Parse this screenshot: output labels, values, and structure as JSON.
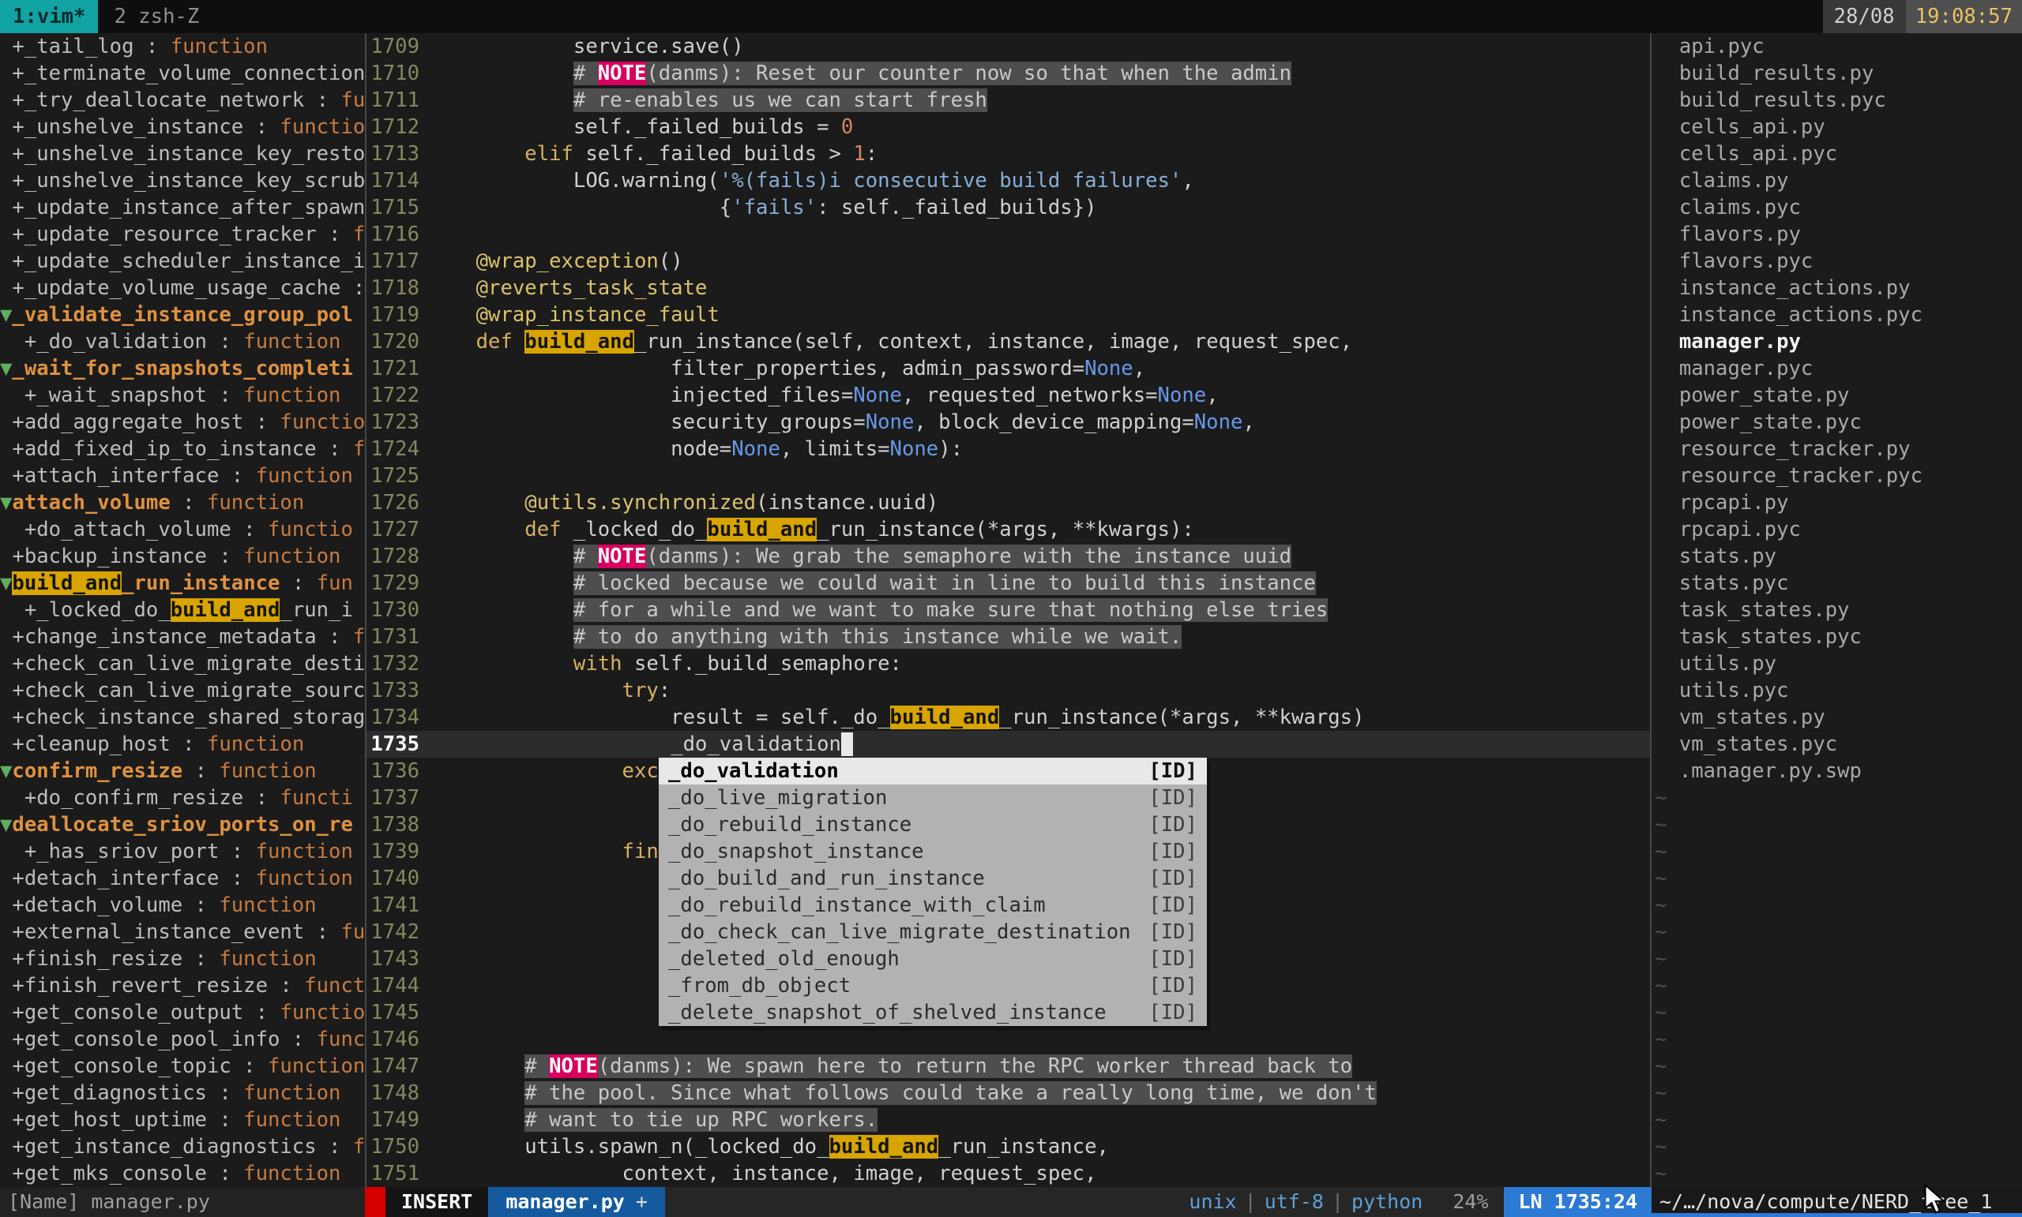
{
  "tmux_bar": {
    "window_active": "1:vim*",
    "window_inactive": "2 zsh-Z",
    "date": "28/08",
    "time": "19:08:57"
  },
  "tagbar": {
    "rows": [
      {
        "segs": [
          [
            "tn",
            " +_tail_log : "
          ],
          [
            "tt",
            "function"
          ]
        ]
      },
      {
        "segs": [
          [
            "tn",
            " +_terminate_volume_connection"
          ]
        ]
      },
      {
        "segs": [
          [
            "tn",
            " +_try_deallocate_network : "
          ],
          [
            "tt",
            "fu"
          ]
        ]
      },
      {
        "segs": [
          [
            "tn",
            " +_unshelve_instance : "
          ],
          [
            "tt",
            "functio"
          ]
        ]
      },
      {
        "segs": [
          [
            "tn",
            " +_unshelve_instance_key_resto"
          ]
        ]
      },
      {
        "segs": [
          [
            "tn",
            " +_unshelve_instance_key_scrub"
          ]
        ]
      },
      {
        "segs": [
          [
            "tn",
            " +_update_instance_after_spawn"
          ]
        ]
      },
      {
        "segs": [
          [
            "tn",
            " +_update_resource_tracker : "
          ],
          [
            "tt",
            "f"
          ]
        ]
      },
      {
        "segs": [
          [
            "tn",
            " +_update_scheduler_instance_i"
          ]
        ]
      },
      {
        "segs": [
          [
            "tn",
            " +_update_volume_usage_cache :"
          ]
        ]
      },
      {
        "segs": [
          [
            "ar",
            "▼"
          ],
          [
            "to",
            "_validate_instance_group_pol"
          ]
        ]
      },
      {
        "segs": [
          [
            "tn",
            "  +_do_validation : "
          ],
          [
            "tt",
            "function"
          ]
        ]
      },
      {
        "segs": [
          [
            "ar",
            "▼"
          ],
          [
            "to",
            "_wait_for_snapshots_completi"
          ]
        ]
      },
      {
        "segs": [
          [
            "tn",
            "  +_wait_snapshot : "
          ],
          [
            "tt",
            "function"
          ]
        ]
      },
      {
        "segs": [
          [
            "tn",
            " +add_aggregate_host : "
          ],
          [
            "tt",
            "functio"
          ]
        ]
      },
      {
        "segs": [
          [
            "tn",
            " +add_fixed_ip_to_instance : "
          ],
          [
            "tt",
            "f"
          ]
        ]
      },
      {
        "segs": [
          [
            "tn",
            " +attach_interface : "
          ],
          [
            "tt",
            "function"
          ]
        ]
      },
      {
        "segs": [
          [
            "ar",
            "▼"
          ],
          [
            "to",
            "attach_volume"
          ],
          [
            "tn",
            " : "
          ],
          [
            "tt",
            "function"
          ]
        ]
      },
      {
        "segs": [
          [
            "tn",
            "  +do_attach_volume : "
          ],
          [
            "tt",
            "functio"
          ]
        ]
      },
      {
        "segs": [
          [
            "tn",
            " +backup_instance : "
          ],
          [
            "tt",
            "function"
          ]
        ]
      },
      {
        "segs": [
          [
            "ar",
            "▼"
          ],
          [
            "h",
            "build_and"
          ],
          [
            "to",
            "_run_instance"
          ],
          [
            "tn",
            " : "
          ],
          [
            "tt",
            "fun"
          ]
        ]
      },
      {
        "segs": [
          [
            "tn",
            "  +_locked_do_"
          ],
          [
            "h",
            "build_and"
          ],
          [
            "tn",
            "_run_i"
          ]
        ]
      },
      {
        "segs": [
          [
            "tn",
            " +change_instance_metadata : "
          ],
          [
            "tt",
            "f"
          ]
        ]
      },
      {
        "segs": [
          [
            "tn",
            " +check_can_live_migrate_desti"
          ]
        ]
      },
      {
        "segs": [
          [
            "tn",
            " +check_can_live_migrate_sourc"
          ]
        ]
      },
      {
        "segs": [
          [
            "tn",
            " +check_instance_shared_storag"
          ]
        ]
      },
      {
        "segs": [
          [
            "tn",
            " +cleanup_host : "
          ],
          [
            "tt",
            "function"
          ]
        ]
      },
      {
        "segs": [
          [
            "ar",
            "▼"
          ],
          [
            "to",
            "confirm_resize"
          ],
          [
            "tn",
            " : "
          ],
          [
            "tt",
            "function"
          ]
        ]
      },
      {
        "segs": [
          [
            "tn",
            "  +do_confirm_resize : "
          ],
          [
            "tt",
            "functi"
          ]
        ]
      },
      {
        "segs": [
          [
            "ar",
            "▼"
          ],
          [
            "to",
            "deallocate_sriov_ports_on_re"
          ]
        ]
      },
      {
        "segs": [
          [
            "tn",
            "  +_has_sriov_port : "
          ],
          [
            "tt",
            "function"
          ]
        ]
      },
      {
        "segs": [
          [
            "tn",
            " +detach_interface : "
          ],
          [
            "tt",
            "function"
          ]
        ]
      },
      {
        "segs": [
          [
            "tn",
            " +detach_volume : "
          ],
          [
            "tt",
            "function"
          ]
        ]
      },
      {
        "segs": [
          [
            "tn",
            " +external_instance_event : "
          ],
          [
            "tt",
            "fu"
          ]
        ]
      },
      {
        "segs": [
          [
            "tn",
            " +finish_resize : "
          ],
          [
            "tt",
            "function"
          ]
        ]
      },
      {
        "segs": [
          [
            "tn",
            " +finish_revert_resize : "
          ],
          [
            "tt",
            "funct"
          ]
        ]
      },
      {
        "segs": [
          [
            "tn",
            " +get_console_output : "
          ],
          [
            "tt",
            "functio"
          ]
        ]
      },
      {
        "segs": [
          [
            "tn",
            " +get_console_pool_info : "
          ],
          [
            "tt",
            "func"
          ]
        ]
      },
      {
        "segs": [
          [
            "tn",
            " +get_console_topic : "
          ],
          [
            "tt",
            "function"
          ]
        ]
      },
      {
        "segs": [
          [
            "tn",
            " +get_diagnostics : "
          ],
          [
            "tt",
            "function"
          ]
        ]
      },
      {
        "segs": [
          [
            "tn",
            " +get_host_uptime : "
          ],
          [
            "tt",
            "function"
          ]
        ]
      },
      {
        "segs": [
          [
            "tn",
            " +get_instance_diagnostics : "
          ],
          [
            "tt",
            "f"
          ]
        ]
      },
      {
        "segs": [
          [
            "tn",
            " +get_mks_console : "
          ],
          [
            "tt",
            "function"
          ]
        ]
      }
    ]
  },
  "editor": {
    "cursor_line": 1735,
    "lines": [
      {
        "num": 1709,
        "segs": [
          [
            "t",
            "            service.save()"
          ]
        ]
      },
      {
        "num": 1710,
        "segs": [
          [
            "t",
            "            "
          ],
          [
            "c",
            "# "
          ],
          [
            "x",
            "NOTE"
          ],
          [
            "c",
            "(danms): Reset our counter now so that when the admin"
          ]
        ]
      },
      {
        "num": 1711,
        "segs": [
          [
            "t",
            "            "
          ],
          [
            "c",
            "# re-enables us we can start fresh"
          ]
        ]
      },
      {
        "num": 1712,
        "segs": [
          [
            "t",
            "            self._failed_builds = "
          ],
          [
            "n",
            "0"
          ]
        ]
      },
      {
        "num": 1713,
        "segs": [
          [
            "t",
            "        "
          ],
          [
            "k",
            "elif"
          ],
          [
            "t",
            " self._failed_builds > "
          ],
          [
            "n",
            "1"
          ],
          [
            "t",
            ":"
          ]
        ]
      },
      {
        "num": 1714,
        "segs": [
          [
            "t",
            "            LOG.warning("
          ],
          [
            "s",
            "'%(fails)i consecutive build failures'"
          ],
          [
            "t",
            ","
          ]
        ]
      },
      {
        "num": 1715,
        "segs": [
          [
            "t",
            "                        {"
          ],
          [
            "s",
            "'fails'"
          ],
          [
            "t",
            ": self._failed_builds})"
          ]
        ]
      },
      {
        "num": 1716,
        "segs": []
      },
      {
        "num": 1717,
        "segs": [
          [
            "t",
            "    "
          ],
          [
            "d",
            "@wrap_exception"
          ],
          [
            "t",
            "()"
          ]
        ]
      },
      {
        "num": 1718,
        "segs": [
          [
            "t",
            "    "
          ],
          [
            "d",
            "@reverts_task_state"
          ]
        ]
      },
      {
        "num": 1719,
        "segs": [
          [
            "t",
            "    "
          ],
          [
            "d",
            "@wrap_instance_fault"
          ]
        ]
      },
      {
        "num": 1720,
        "segs": [
          [
            "t",
            "    "
          ],
          [
            "k",
            "def"
          ],
          [
            "t",
            " "
          ],
          [
            "h",
            "build_and"
          ],
          [
            "t",
            "_run_instance(self, context, instance, image, request_spec,"
          ]
        ]
      },
      {
        "num": 1721,
        "segs": [
          [
            "t",
            "                    filter_properties, admin_password="
          ],
          [
            "N",
            "None"
          ],
          [
            "t",
            ","
          ]
        ]
      },
      {
        "num": 1722,
        "segs": [
          [
            "t",
            "                    injected_files="
          ],
          [
            "N",
            "None"
          ],
          [
            "t",
            ", requested_networks="
          ],
          [
            "N",
            "None"
          ],
          [
            "t",
            ","
          ]
        ]
      },
      {
        "num": 1723,
        "segs": [
          [
            "t",
            "                    security_groups="
          ],
          [
            "N",
            "None"
          ],
          [
            "t",
            ", block_device_mapping="
          ],
          [
            "N",
            "None"
          ],
          [
            "t",
            ","
          ]
        ]
      },
      {
        "num": 1724,
        "segs": [
          [
            "t",
            "                    node="
          ],
          [
            "N",
            "None"
          ],
          [
            "t",
            ", limits="
          ],
          [
            "N",
            "None"
          ],
          [
            "t",
            "):"
          ]
        ]
      },
      {
        "num": 1725,
        "segs": []
      },
      {
        "num": 1726,
        "segs": [
          [
            "t",
            "        "
          ],
          [
            "d",
            "@utils.synchronized"
          ],
          [
            "t",
            "(instance.uuid)"
          ]
        ]
      },
      {
        "num": 1727,
        "segs": [
          [
            "t",
            "        "
          ],
          [
            "k",
            "def"
          ],
          [
            "t",
            " _locked_do_"
          ],
          [
            "h",
            "build_and"
          ],
          [
            "t",
            "_run_instance(*args, **kwargs):"
          ]
        ]
      },
      {
        "num": 1728,
        "segs": [
          [
            "t",
            "            "
          ],
          [
            "c",
            "# "
          ],
          [
            "x",
            "NOTE"
          ],
          [
            "c",
            "(danms): We grab the semaphore with the instance uuid"
          ]
        ]
      },
      {
        "num": 1729,
        "segs": [
          [
            "t",
            "            "
          ],
          [
            "c",
            "# locked because we could wait in line to build this instance"
          ]
        ]
      },
      {
        "num": 1730,
        "segs": [
          [
            "t",
            "            "
          ],
          [
            "c",
            "# for a while and we want to make sure that nothing else tries"
          ]
        ]
      },
      {
        "num": 1731,
        "segs": [
          [
            "t",
            "            "
          ],
          [
            "c",
            "# to do anything with this instance while we wait."
          ]
        ]
      },
      {
        "num": 1732,
        "segs": [
          [
            "t",
            "            "
          ],
          [
            "k",
            "with"
          ],
          [
            "t",
            " self._build_semaphore:"
          ]
        ]
      },
      {
        "num": 1733,
        "segs": [
          [
            "t",
            "                "
          ],
          [
            "k",
            "try"
          ],
          [
            "t",
            ":"
          ]
        ]
      },
      {
        "num": 1734,
        "segs": [
          [
            "t",
            "                    result = self._do_"
          ],
          [
            "h",
            "build_and"
          ],
          [
            "t",
            "_run_instance(*args, **kwargs)"
          ]
        ]
      },
      {
        "num": 1735,
        "segs": [
          [
            "t",
            "                    _do_validation"
          ],
          [
            "cur",
            " "
          ]
        ]
      },
      {
        "num": 1736,
        "segs": [
          [
            "t",
            "                "
          ],
          [
            "k",
            "exc"
          ]
        ]
      },
      {
        "num": 1737,
        "segs": []
      },
      {
        "num": 1738,
        "segs": []
      },
      {
        "num": 1739,
        "segs": [
          [
            "t",
            "                "
          ],
          [
            "k",
            "fin"
          ]
        ]
      },
      {
        "num": 1740,
        "segs": []
      },
      {
        "num": 1741,
        "segs": []
      },
      {
        "num": 1742,
        "segs": []
      },
      {
        "num": 1743,
        "segs": []
      },
      {
        "num": 1744,
        "segs": []
      },
      {
        "num": 1745,
        "segs": []
      },
      {
        "num": 1746,
        "segs": []
      },
      {
        "num": 1747,
        "segs": [
          [
            "t",
            "        "
          ],
          [
            "c",
            "# "
          ],
          [
            "x",
            "NOTE"
          ],
          [
            "c",
            "(danms): We spawn here to return the RPC worker thread back to"
          ]
        ]
      },
      {
        "num": 1748,
        "segs": [
          [
            "t",
            "        "
          ],
          [
            "c",
            "# the pool. Since what follows could take a really long time, we don't"
          ]
        ]
      },
      {
        "num": 1749,
        "segs": [
          [
            "t",
            "        "
          ],
          [
            "c",
            "# want to tie up RPC workers."
          ]
        ]
      },
      {
        "num": 1750,
        "segs": [
          [
            "t",
            "        utils.spawn_n(_locked_do_"
          ],
          [
            "h",
            "build_and"
          ],
          [
            "t",
            "_run_instance,"
          ]
        ]
      },
      {
        "num": 1751,
        "segs": [
          [
            "t",
            "                context, instance, image, request_spec,"
          ]
        ]
      }
    ]
  },
  "popup": {
    "selected_index": 0,
    "kind": "[ID]",
    "items": [
      "_do_validation",
      "_do_live_migration",
      "_do_rebuild_instance",
      "_do_snapshot_instance",
      "_do_build_and_run_instance",
      "_do_rebuild_instance_with_claim",
      "_do_check_can_live_migrate_destination",
      "_deleted_old_enough",
      "_from_db_object",
      "_delete_snapshot_of_shelved_instance"
    ]
  },
  "nerdtree": {
    "active_index": 11,
    "tilde_char": "~",
    "empty_line_count": 15,
    "files": [
      "api.pyc",
      "build_results.py",
      "build_results.pyc",
      "cells_api.py",
      "cells_api.pyc",
      "claims.py",
      "claims.pyc",
      "flavors.py",
      "flavors.pyc",
      "instance_actions.py",
      "instance_actions.pyc",
      "manager.py",
      "manager.pyc",
      "power_state.py",
      "power_state.pyc",
      "resource_tracker.py",
      "resource_tracker.pyc",
      "rpcapi.py",
      "rpcapi.pyc",
      "stats.py",
      "stats.pyc",
      "task_states.py",
      "task_states.pyc",
      "utils.py",
      "utils.pyc",
      "vm_states.py",
      "vm_states.pyc",
      ".manager.py.swp"
    ]
  },
  "statusbar": {
    "left_window_status": "[Name] manager.py",
    "mode": "INSERT",
    "file": "manager.py",
    "modified": "+",
    "fileformat": "unix",
    "encoding": "utf-8",
    "filetype": "python",
    "pipe": "|",
    "percent": "24%",
    "position": "LN 1735:24",
    "right_window_status": "~/…/nova/compute/NERD_tree_1"
  },
  "colors": {
    "accent_teal": "#12a3a3",
    "search_highlight": "#d7a400",
    "note_badge": "#d7005f",
    "statusline_blue": "#2d7ad4",
    "file_segment_blue": "#155a9e",
    "mode_accent_red": "#d70000",
    "editor_bg": "#1b1b1b"
  }
}
